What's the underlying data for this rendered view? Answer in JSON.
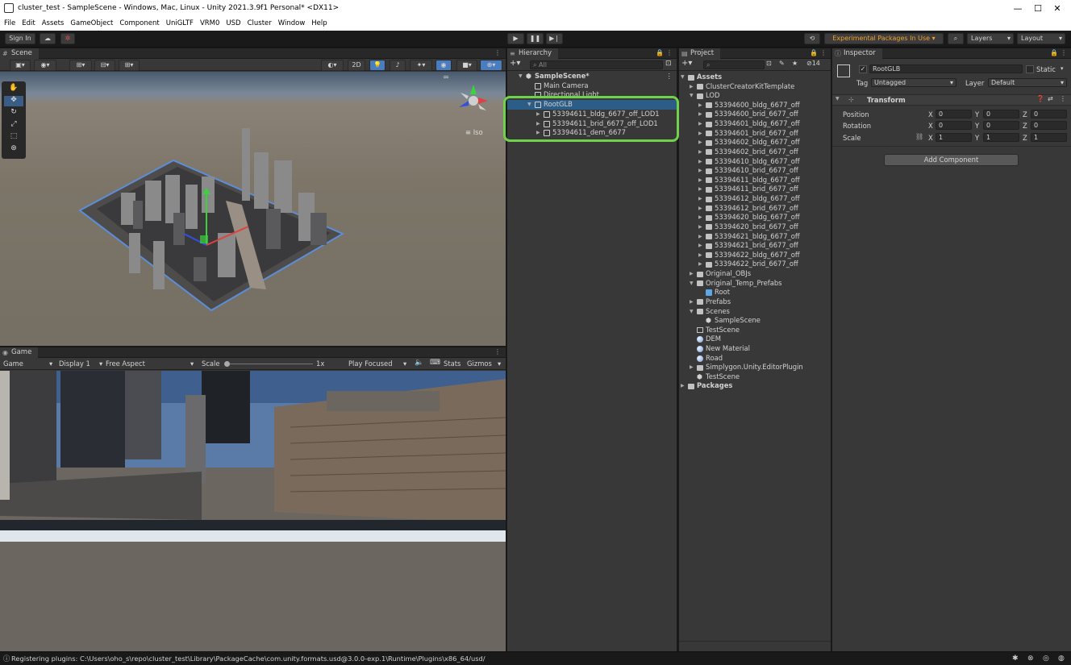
{
  "window": {
    "title": "cluster_test - SampleScene - Windows, Mac, Linux - Unity 2021.3.9f1 Personal* <DX11>",
    "minimize": "—",
    "maximize": "☐",
    "close": "✕"
  },
  "menu": [
    "File",
    "Edit",
    "Assets",
    "GameObject",
    "Component",
    "UniGLTF",
    "VRM0",
    "USD",
    "Cluster",
    "Window",
    "Help"
  ],
  "toolbar": {
    "sign_in": "Sign In",
    "experimental": "Experimental Packages In Use",
    "layers": "Layers",
    "layout": "Layout"
  },
  "scene": {
    "tab": "Scene",
    "mode_2d": "2D",
    "iso": "Iso"
  },
  "game": {
    "tab": "Game",
    "mode": "Game",
    "display": "Display 1",
    "aspect": "Free Aspect",
    "scale_label": "Scale",
    "scale_value": "1x",
    "play_focused": "Play Focused",
    "stats": "Stats",
    "gizmos": "Gizmos"
  },
  "hierarchy": {
    "tab": "Hierarchy",
    "search_placeholder": "All",
    "rows": [
      {
        "label": "SampleScene*",
        "indent": 0,
        "arrow": "▼",
        "icon": "unity-scene-icon",
        "bold": true
      },
      {
        "label": "Main Camera",
        "indent": 1,
        "arrow": "",
        "icon": "cube-icon"
      },
      {
        "label": "Directional Light",
        "indent": 1,
        "arrow": "",
        "icon": "cube-icon"
      },
      {
        "label": "RootGLB",
        "indent": 1,
        "arrow": "▼",
        "icon": "cube-icon",
        "selected": true
      },
      {
        "label": "53394611_bldg_6677_off_LOD1",
        "indent": 2,
        "arrow": "▶",
        "icon": "cube-icon"
      },
      {
        "label": "53394611_brid_6677_off_LOD1",
        "indent": 2,
        "arrow": "▶",
        "icon": "cube-icon"
      },
      {
        "label": "53394611_dem_6677",
        "indent": 2,
        "arrow": "▶",
        "icon": "cube-icon"
      }
    ]
  },
  "project": {
    "tab": "Project",
    "hidden_count": "14",
    "rows": [
      {
        "label": "Assets",
        "indent": 0,
        "arrow": "▼",
        "icon": "folder-icon",
        "bold": true
      },
      {
        "label": "ClusterCreatorKitTemplate",
        "indent": 1,
        "arrow": "▶",
        "icon": "folder-icon"
      },
      {
        "label": "LOD",
        "indent": 1,
        "arrow": "▼",
        "icon": "folder-icon"
      },
      {
        "label": "53394600_bldg_6677_off",
        "indent": 2,
        "arrow": "▶",
        "icon": "folder-icon"
      },
      {
        "label": "53394600_brid_6677_off",
        "indent": 2,
        "arrow": "▶",
        "icon": "folder-icon"
      },
      {
        "label": "53394601_bldg_6677_off",
        "indent": 2,
        "arrow": "▶",
        "icon": "folder-icon"
      },
      {
        "label": "53394601_brid_6677_off",
        "indent": 2,
        "arrow": "▶",
        "icon": "folder-icon"
      },
      {
        "label": "53394602_bldg_6677_off",
        "indent": 2,
        "arrow": "▶",
        "icon": "folder-icon"
      },
      {
        "label": "53394602_brid_6677_off",
        "indent": 2,
        "arrow": "▶",
        "icon": "folder-icon"
      },
      {
        "label": "53394610_bldg_6677_off",
        "indent": 2,
        "arrow": "▶",
        "icon": "folder-icon"
      },
      {
        "label": "53394610_brid_6677_off",
        "indent": 2,
        "arrow": "▶",
        "icon": "folder-icon"
      },
      {
        "label": "53394611_bldg_6677_off",
        "indent": 2,
        "arrow": "▶",
        "icon": "folder-icon"
      },
      {
        "label": "53394611_brid_6677_off",
        "indent": 2,
        "arrow": "▶",
        "icon": "folder-icon"
      },
      {
        "label": "53394612_bldg_6677_off",
        "indent": 2,
        "arrow": "▶",
        "icon": "folder-icon"
      },
      {
        "label": "53394612_brid_6677_off",
        "indent": 2,
        "arrow": "▶",
        "icon": "folder-icon"
      },
      {
        "label": "53394620_bldg_6677_off",
        "indent": 2,
        "arrow": "▶",
        "icon": "folder-icon"
      },
      {
        "label": "53394620_brid_6677_off",
        "indent": 2,
        "arrow": "▶",
        "icon": "folder-icon"
      },
      {
        "label": "53394621_bldg_6677_off",
        "indent": 2,
        "arrow": "▶",
        "icon": "folder-icon"
      },
      {
        "label": "53394621_brid_6677_off",
        "indent": 2,
        "arrow": "▶",
        "icon": "folder-icon"
      },
      {
        "label": "53394622_bldg_6677_off",
        "indent": 2,
        "arrow": "▶",
        "icon": "folder-icon"
      },
      {
        "label": "53394622_brid_6677_off",
        "indent": 2,
        "arrow": "▶",
        "icon": "folder-icon"
      },
      {
        "label": "Original_OBJs",
        "indent": 1,
        "arrow": "▶",
        "icon": "folder-icon"
      },
      {
        "label": "Original_Temp_Prefabs",
        "indent": 1,
        "arrow": "▼",
        "icon": "folder-icon"
      },
      {
        "label": "Root",
        "indent": 2,
        "arrow": "",
        "icon": "prefab-icon"
      },
      {
        "label": "Prefabs",
        "indent": 1,
        "arrow": "▶",
        "icon": "folder-icon"
      },
      {
        "label": "Scenes",
        "indent": 1,
        "arrow": "▼",
        "icon": "folder-icon"
      },
      {
        "label": "SampleScene",
        "indent": 2,
        "arrow": "",
        "icon": "unity-scene-icon"
      },
      {
        "label": "TestScene",
        "indent": 1,
        "arrow": "",
        "icon": "folder-outline-icon"
      },
      {
        "label": "DEM",
        "indent": 1,
        "arrow": "",
        "icon": "material-icon"
      },
      {
        "label": "New Material",
        "indent": 1,
        "arrow": "",
        "icon": "material-icon"
      },
      {
        "label": "Road",
        "indent": 1,
        "arrow": "",
        "icon": "material-icon"
      },
      {
        "label": "Simplygon.Unity.EditorPlugin",
        "indent": 1,
        "arrow": "▶",
        "icon": "folder-icon"
      },
      {
        "label": "TestScene",
        "indent": 1,
        "arrow": "",
        "icon": "unity-scene-icon"
      },
      {
        "label": "Packages",
        "indent": 0,
        "arrow": "▶",
        "icon": "folder-icon",
        "bold": true
      }
    ]
  },
  "inspector": {
    "tab": "Inspector",
    "object_name": "RootGLB",
    "static_label": "Static",
    "tag_label": "Tag",
    "tag_value": "Untagged",
    "layer_label": "Layer",
    "layer_value": "Default",
    "transform_label": "Transform",
    "position_label": "Position",
    "rotation_label": "Rotation",
    "scale_label": "Scale",
    "pos": {
      "x": "0",
      "y": "0",
      "z": "0"
    },
    "rot": {
      "x": "0",
      "y": "0",
      "z": "0"
    },
    "scl": {
      "x": "1",
      "y": "1",
      "z": "1"
    },
    "axis_x": "X",
    "axis_y": "Y",
    "axis_z": "Z",
    "add_component": "Add Component"
  },
  "status": {
    "message": "Registering plugins: C:\\Users\\oho_s\\repo\\cluster_test\\Library\\PackageCache\\com.unity.formats.usd@3.0.0-exp.1\\Runtime\\Plugins\\x86_64/usd/"
  },
  "colors": {
    "selection": "#2c5d87",
    "highlight_box": "#6fd24a",
    "experimental": "#f0a030"
  }
}
